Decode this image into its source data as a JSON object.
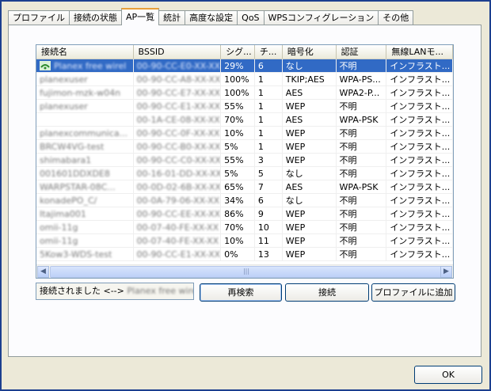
{
  "tabs": [
    "プロファイル",
    "接続の状態",
    "AP一覧",
    "統計",
    "高度な設定",
    "QoS",
    "WPSコンフィグレーション",
    "その他"
  ],
  "active_tab": "AP一覧",
  "columns": [
    "接続名",
    "BSSID",
    "シグ...",
    "チ...",
    "暗号化",
    "認証",
    "無線LANモ..."
  ],
  "rows": [
    {
      "name": "Planex free wirel",
      "bssid": "00-90-CC-E0-XX-XX",
      "signal": "29%",
      "channel": "6",
      "enc": "なし",
      "auth": "不明",
      "mode": "インフラスト..."
    },
    {
      "name": "planexuser",
      "bssid": "00-90-CC-A8-XX-XX",
      "signal": "100%",
      "channel": "1",
      "enc": "TKIP;AES",
      "auth": "WPA-PS...",
      "mode": "インフラスト..."
    },
    {
      "name": "fujimon-mzk-w04n",
      "bssid": "00-90-CC-E7-XX-XX",
      "signal": "100%",
      "channel": "1",
      "enc": "AES",
      "auth": "WPA2-P...",
      "mode": "インフラスト..."
    },
    {
      "name": "planexuser",
      "bssid": "00-90-CC-E1-XX-XX",
      "signal": "55%",
      "channel": "1",
      "enc": "WEP",
      "auth": "不明",
      "mode": "インフラスト..."
    },
    {
      "name": "",
      "bssid": "00-1A-CE-08-XX-XX",
      "signal": "70%",
      "channel": "1",
      "enc": "AES",
      "auth": "WPA-PSK",
      "mode": "インフラスト..."
    },
    {
      "name": "planexcommunica...",
      "bssid": "00-90-CC-0F-XX-XX",
      "signal": "10%",
      "channel": "1",
      "enc": "WEP",
      "auth": "不明",
      "mode": "インフラスト..."
    },
    {
      "name": "BRCW4VG-test",
      "bssid": "00-90-CC-B0-XX-XX",
      "signal": "5%",
      "channel": "1",
      "enc": "WEP",
      "auth": "不明",
      "mode": "インフラスト..."
    },
    {
      "name": "shimabara1",
      "bssid": "00-90-CC-C0-XX-XX",
      "signal": "55%",
      "channel": "3",
      "enc": "WEP",
      "auth": "不明",
      "mode": "インフラスト..."
    },
    {
      "name": "001601DDXDE8",
      "bssid": "00-16-01-DD-XX-XX",
      "signal": "5%",
      "channel": "5",
      "enc": "なし",
      "auth": "不明",
      "mode": "インフラスト..."
    },
    {
      "name": "WARPSTAR-08C...",
      "bssid": "00-0D-02-6B-XX-XX",
      "signal": "65%",
      "channel": "7",
      "enc": "AES",
      "auth": "WPA-PSK",
      "mode": "インフラスト..."
    },
    {
      "name": "konadePO_C/",
      "bssid": "00-0A-79-06-XX-XX",
      "signal": "34%",
      "channel": "6",
      "enc": "なし",
      "auth": "不明",
      "mode": "インフラスト..."
    },
    {
      "name": "Itajima001",
      "bssid": "00-90-CC-EE-XX-XX",
      "signal": "86%",
      "channel": "9",
      "enc": "WEP",
      "auth": "不明",
      "mode": "インフラスト..."
    },
    {
      "name": "omii-11g",
      "bssid": "00-07-40-FE-XX-XX",
      "signal": "70%",
      "channel": "10",
      "enc": "WEP",
      "auth": "不明",
      "mode": "インフラスト..."
    },
    {
      "name": "omii-11g",
      "bssid": "00-07-40-FE-XX-XX",
      "signal": "10%",
      "channel": "11",
      "enc": "WEP",
      "auth": "不明",
      "mode": "インフラスト..."
    },
    {
      "name": "5Kow3-WDS-test",
      "bssid": "00-90-CC-E1-XX-XX",
      "signal": "0%",
      "channel": "13",
      "enc": "WEP",
      "auth": "不明",
      "mode": "インフラスト..."
    }
  ],
  "status_prefix": "接続されました <-->",
  "status_name": "Planex free wirel",
  "buttons": {
    "rescan": "再検索",
    "connect": "接続",
    "add_profile": "プロファイルに追加",
    "ok": "OK"
  },
  "scroll_grip": "|||",
  "colors": {
    "selected_row": "#316ac5",
    "tab_highlight": "#e8a03a"
  }
}
